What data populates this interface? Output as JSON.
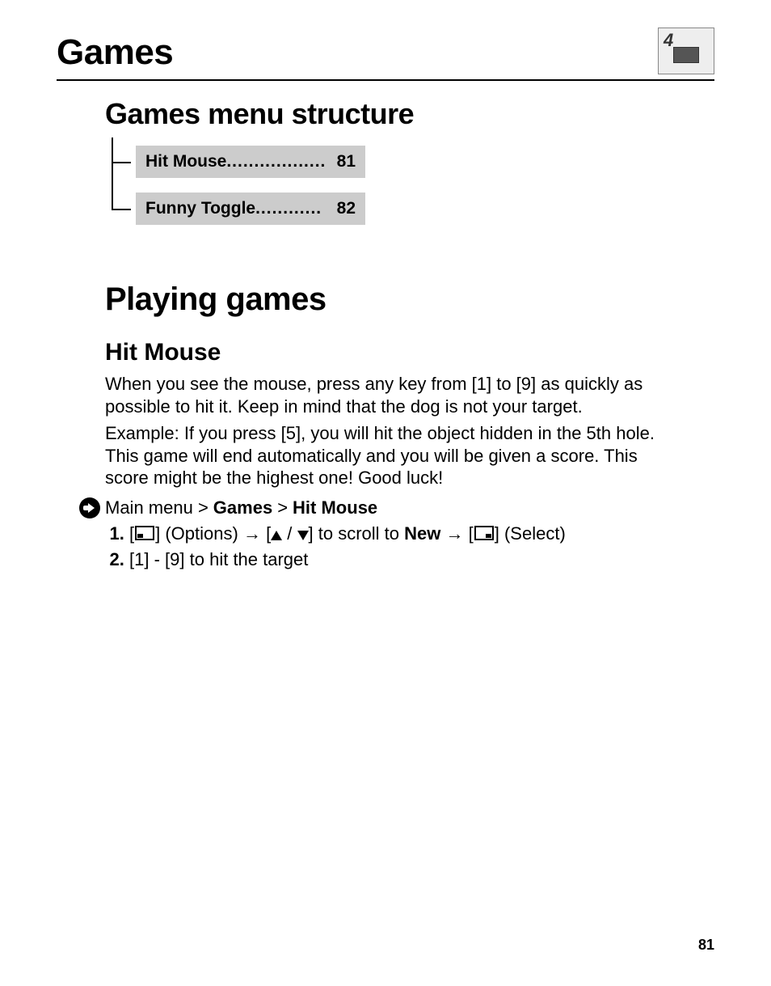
{
  "page": {
    "title": "Games",
    "number": "81"
  },
  "menu_section": {
    "heading": "Games menu structure",
    "items": [
      {
        "label": "Hit Mouse",
        "page": "81"
      },
      {
        "label": "Funny Toggle",
        "page": "82"
      }
    ]
  },
  "play_section": {
    "heading": "Playing games",
    "game": {
      "name": "Hit Mouse",
      "paragraph1": "When you see the mouse, press any key from [1] to [9] as quickly as possible to hit it. Keep in mind that the dog is not your target.",
      "paragraph2": "Example: If you press [5], you will hit the object hidden in the 5th hole. This game will end automatically and you will be given a score. This score might be the highest one! Good luck!",
      "nav_path": {
        "prefix": "Main menu >",
        "mid": "Games",
        "sep": ">",
        "end": "Hit Mouse"
      },
      "steps": [
        {
          "options": "(Options)",
          "scroll_to": "New",
          "select": "(Select)",
          "to_scroll": "to scroll to"
        },
        {
          "text": "[1] - [9] to hit the target"
        }
      ]
    }
  },
  "icons": {
    "corner_number": "4"
  }
}
